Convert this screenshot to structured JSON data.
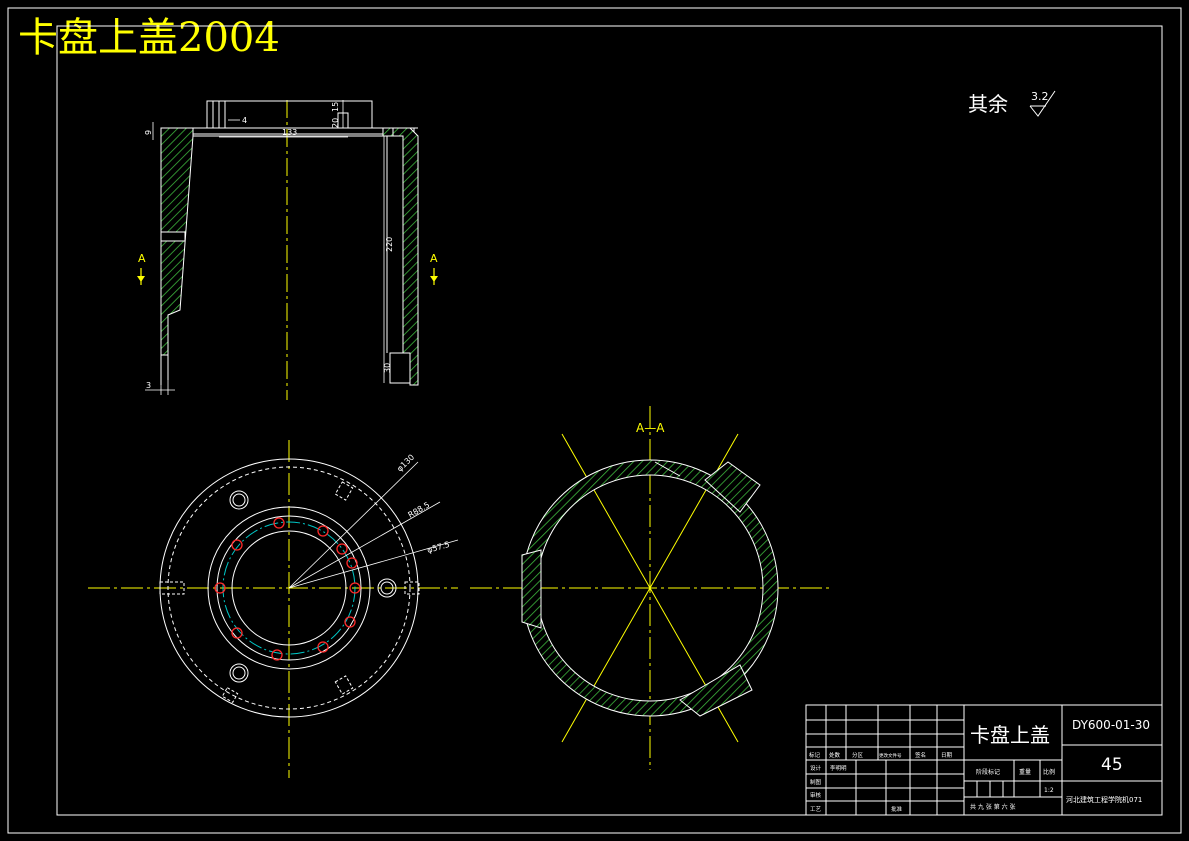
{
  "title_overlay": "卡盘上盖2004",
  "roughness_note": {
    "label": "其余",
    "value": "3.2"
  },
  "section_marks": {
    "left": "A",
    "right": "A",
    "section_title": "A—A"
  },
  "dimensions": {
    "d_9": "9",
    "d_4": "4",
    "d_133": "133",
    "d_20": "20",
    "d_15": "15",
    "d_220": "220",
    "d_30": "30",
    "d_3": "3",
    "d_phi130": "φ130",
    "d_r88_5": "R88.5",
    "d_phi57_5": "φ57.5"
  },
  "title_block": {
    "part_name": "卡盘上盖",
    "drawing_no": "DY600-01-30",
    "material": "45",
    "school": "河北建筑工程学院机071",
    "scale_label": "比例",
    "scale_value": "1:2",
    "weight_label": "重量",
    "stage_label": "阶段标记",
    "sheet_info": "共 九 张   第 六 张",
    "header_cells": [
      "标记",
      "处数",
      "分区",
      "更改文件号",
      "签名",
      "日期"
    ],
    "designer_label": "设计",
    "designer_name": "李明明",
    "drafter_label": "制图",
    "checker_label": "审核",
    "process_label": "工艺",
    "approve_label": "批准"
  }
}
